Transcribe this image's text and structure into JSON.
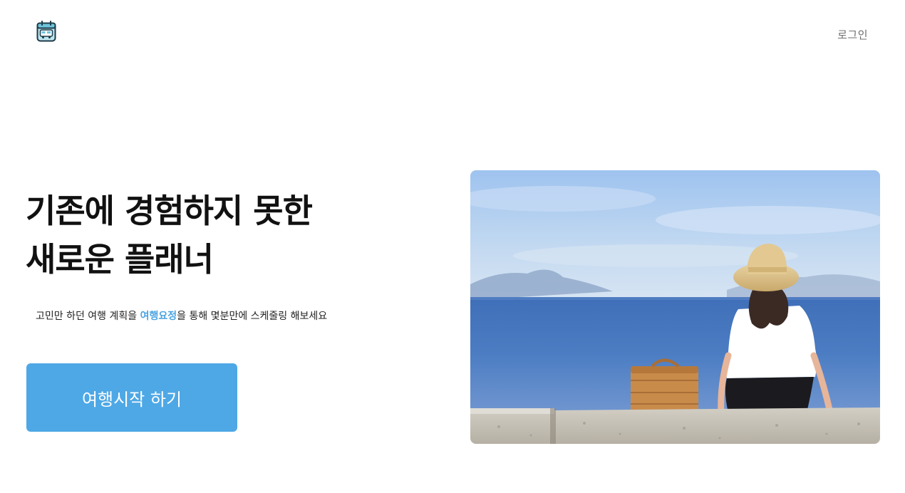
{
  "header": {
    "logo_icon": "calendar-bus-icon",
    "login_label": "로그인"
  },
  "hero": {
    "headline_line1": "기존에 경험하지 못한",
    "headline_line2": "새로운 플래너",
    "subtext_prefix": "고민만 하던 여행 계획을 ",
    "subtext_brand": "여행요정",
    "subtext_suffix": "을 통해 몇분만에 스케줄링 해보세요",
    "cta_label": "여행시작 하기",
    "image_description_icon": "beach-woman-photo"
  },
  "colors": {
    "accent": "#4ea8e6",
    "brand_text": "#4aa3e2",
    "headline": "#111111",
    "muted": "#6f6f6f"
  }
}
